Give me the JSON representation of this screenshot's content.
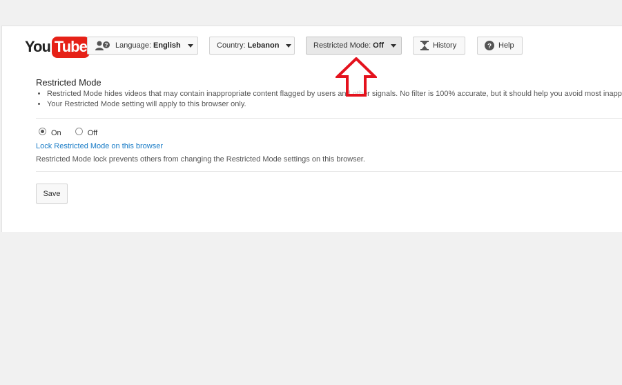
{
  "logo": {
    "you": "You",
    "tube": "Tube"
  },
  "toolbar": {
    "language_label": "Language:",
    "language_value": "English",
    "country_label": "Country:",
    "country_value": "Lebanon",
    "restricted_label": "Restricted Mode:",
    "restricted_value": "Off",
    "history_label": "History",
    "help_label": "Help"
  },
  "restricted": {
    "title": "Restricted Mode",
    "bullets": [
      "Restricted Mode hides videos that may contain inappropriate content flagged by users and other signals. No filter is 100% accurate, but it should help you avoid most inappropriate content.",
      "Your Restricted Mode setting will apply to this browser only."
    ],
    "option_on": "On",
    "option_off": "Off",
    "selected": "On",
    "lock_link": "Lock Restricted Mode on this browser",
    "lock_description": "Restricted Mode lock prevents others from changing the Restricted Mode settings on this browser.",
    "save_label": "Save"
  },
  "colors": {
    "brand": "#e62117",
    "link": "#167ac6",
    "arrow": "#e4121d"
  },
  "icons": [
    "language-icon",
    "chevron-down-icon",
    "hourglass-icon",
    "help-icon",
    "up-arrow-annotation"
  ]
}
